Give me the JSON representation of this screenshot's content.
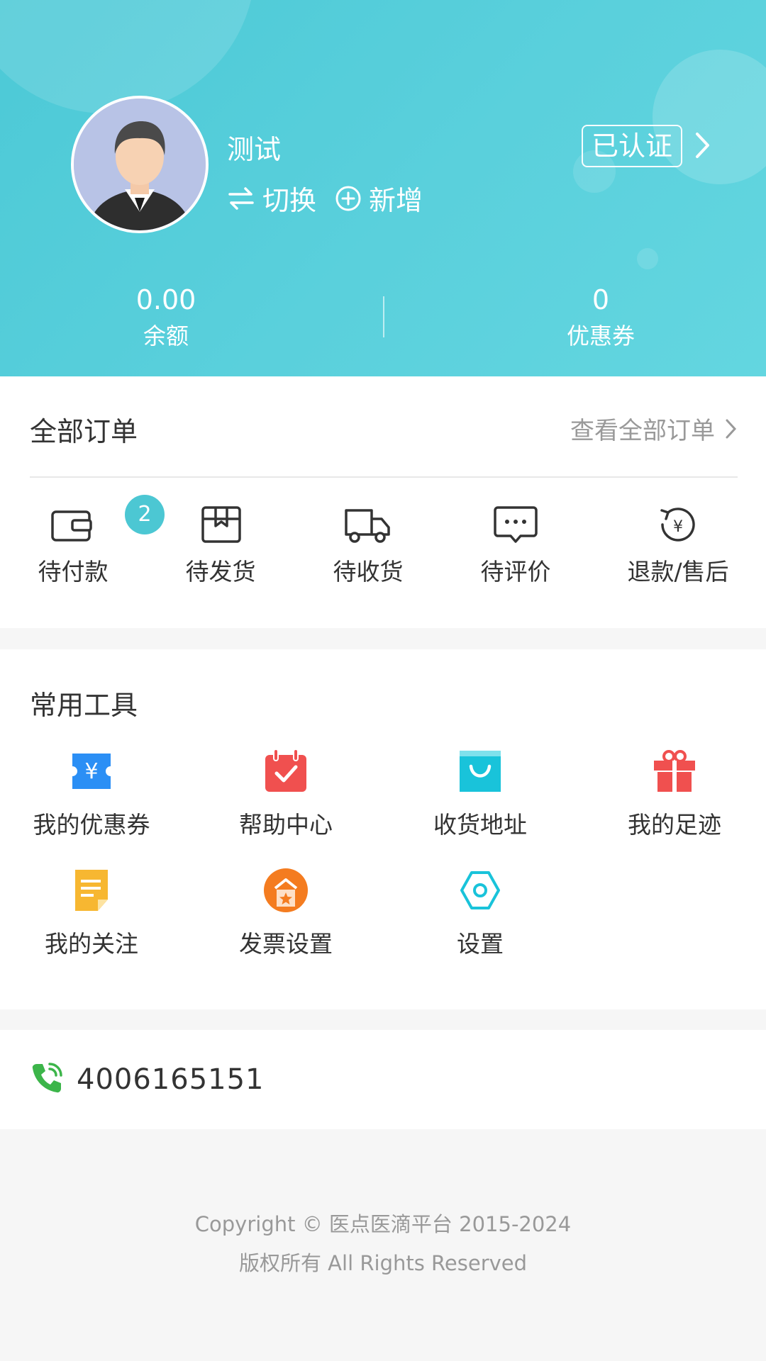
{
  "profile": {
    "name": "测试",
    "switch_label": "切换",
    "add_label": "新增",
    "verified_label": "已认证"
  },
  "stats": [
    {
      "value": "0.00",
      "label": "余额"
    },
    {
      "value": "0",
      "label": "优惠券"
    }
  ],
  "orders": {
    "title": "全部订单",
    "view_all": "查看全部订单",
    "items": [
      {
        "label": "待付款",
        "badge": "2",
        "icon": "wallet-icon"
      },
      {
        "label": "待发货",
        "icon": "package-icon"
      },
      {
        "label": "待收货",
        "icon": "truck-icon"
      },
      {
        "label": "待评价",
        "icon": "comment-icon"
      },
      {
        "label": "退款/售后",
        "icon": "refund-icon"
      }
    ]
  },
  "tools": {
    "title": "常用工具",
    "items": [
      {
        "label": "我的优惠券",
        "icon": "coupon-icon",
        "color": "#2b8ff5"
      },
      {
        "label": "帮助中心",
        "icon": "calendar-check-icon",
        "color": "#f0504f"
      },
      {
        "label": "收货地址",
        "icon": "shopping-bag-icon",
        "color": "#19c3da"
      },
      {
        "label": "我的足迹",
        "icon": "gift-icon",
        "color": "#f0504f"
      },
      {
        "label": "我的关注",
        "icon": "note-icon",
        "color": "#f7b731"
      },
      {
        "label": "发票设置",
        "icon": "invoice-star-icon",
        "color": "#f47c20"
      },
      {
        "label": "设置",
        "icon": "settings-hex-icon",
        "color": "#19c3da"
      }
    ]
  },
  "contact": {
    "phone": "4006165151",
    "icon": "phone-icon",
    "color": "#3cb54a"
  },
  "footer": {
    "copyright": "Copyright © 医点医滴平台 2015-2024",
    "rights": "版权所有 All Rights Reserved"
  },
  "colors": {
    "header": "#56cfdb",
    "badge": "#4cc7d3"
  }
}
